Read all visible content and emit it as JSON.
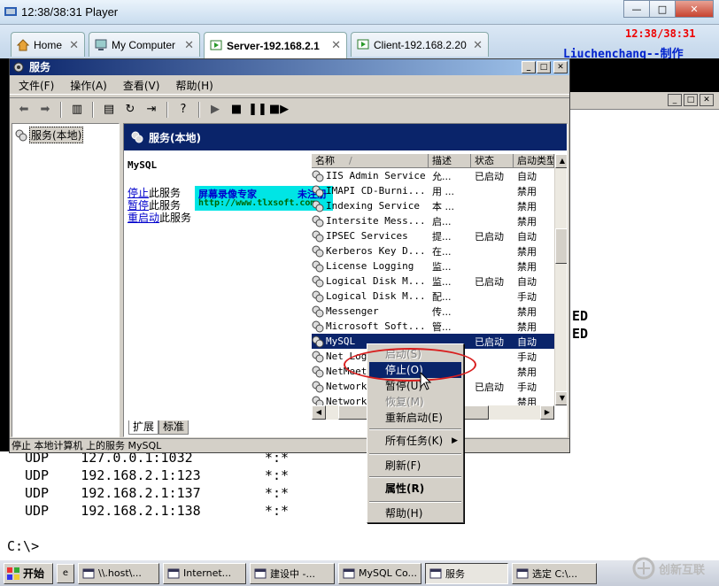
{
  "player": {
    "title": "12:38/38:31 Player",
    "controls": {
      "minimize": "—",
      "restore": "□",
      "close": "✕"
    }
  },
  "tabs": [
    {
      "label": "Home",
      "close": "✕"
    },
    {
      "label": "My Computer",
      "close": "✕"
    },
    {
      "label": "Server-192.168.2.1",
      "close": "✕"
    },
    {
      "label": "Client-192.168.2.20",
      "close": "✕"
    }
  ],
  "overlay": {
    "clock": "12:38/38:31",
    "author": "Liuchenchang--制作"
  },
  "services_window": {
    "title": "服务",
    "controls": {
      "minimize": "_",
      "maximize": "□",
      "close": "✕"
    },
    "menu": [
      "文件(F)",
      "操作(A)",
      "查看(V)",
      "帮助(H)"
    ],
    "tree_root": "服务(本地)",
    "header": "服务(本地)",
    "selected_service_name": "MySQL",
    "actions": [
      {
        "link": "停止",
        "suffix": "此服务"
      },
      {
        "link": "暂停",
        "suffix": "此服务"
      },
      {
        "link": "重启动",
        "suffix": "此服务"
      }
    ],
    "columns": [
      "名称",
      "描述",
      "状态",
      "启动类型"
    ],
    "sort_marker": "/",
    "services": [
      {
        "name": "IIS Admin Service",
        "desc": "允...",
        "status": "已启动",
        "startup": "自动",
        "selected": false
      },
      {
        "name": "IMAPI CD-Burni...",
        "desc": "用 ...",
        "status": "",
        "startup": "禁用",
        "selected": false
      },
      {
        "name": "Indexing Service",
        "desc": "本 ...",
        "status": "",
        "startup": "禁用",
        "selected": false
      },
      {
        "name": "Intersite Mess...",
        "desc": "启...",
        "status": "",
        "startup": "禁用",
        "selected": false
      },
      {
        "name": "IPSEC Services",
        "desc": "提...",
        "status": "已启动",
        "startup": "自动",
        "selected": false
      },
      {
        "name": "Kerberos Key D...",
        "desc": "在...",
        "status": "",
        "startup": "禁用",
        "selected": false
      },
      {
        "name": "License Logging",
        "desc": "监...",
        "status": "",
        "startup": "禁用",
        "selected": false
      },
      {
        "name": "Logical Disk M...",
        "desc": "监...",
        "status": "已启动",
        "startup": "自动",
        "selected": false
      },
      {
        "name": "Logical Disk M...",
        "desc": "配...",
        "status": "",
        "startup": "手动",
        "selected": false
      },
      {
        "name": "Messenger",
        "desc": "传...",
        "status": "",
        "startup": "禁用",
        "selected": false
      },
      {
        "name": "Microsoft Soft...",
        "desc": "管...",
        "status": "",
        "startup": "禁用",
        "selected": false
      },
      {
        "name": "MySQL",
        "desc": "",
        "status": "已启动",
        "startup": "自动",
        "selected": true
      },
      {
        "name": "Net Logon",
        "desc": "",
        "status": "",
        "startup": "手动",
        "selected": false
      },
      {
        "name": "NetMeeting",
        "desc": "",
        "status": "",
        "startup": "禁用",
        "selected": false
      },
      {
        "name": "Network",
        "desc": "",
        "status": "已启动",
        "startup": "手动",
        "selected": false
      },
      {
        "name": "Network",
        "desc": "",
        "status": "",
        "startup": "禁用",
        "selected": false
      }
    ],
    "view_tabs": [
      "扩展",
      "标准"
    ],
    "status_text": "停止 本地计算机 上的服务 MySQL"
  },
  "watermark": {
    "line1": "屏幕录像专家",
    "line1b": "未注册",
    "line2": "http://www.tlxsoft.com"
  },
  "context_menu": {
    "items": [
      {
        "label": "启动(S)",
        "disabled": true
      },
      {
        "label": "停止(O)",
        "highlighted": true
      },
      {
        "label": "暂停(U)"
      },
      {
        "label": "恢复(M)",
        "disabled": true
      },
      {
        "label": "重新启动(E)"
      },
      {
        "label": "所有任务(K)",
        "submenu": "▶"
      },
      {
        "label": "刷新(F)"
      },
      {
        "label": "属性(R)",
        "bold": true
      },
      {
        "label": "帮助(H)"
      }
    ]
  },
  "background_cmd": {
    "right_fragments": [
      "ED",
      "ED"
    ],
    "lines": [
      "UDP    127.0.0.1:1032         *:*",
      "UDP    192.168.2.1:123        *:*",
      "UDP    192.168.2.1:137        *:*",
      "UDP    192.168.2.1:138        *:*"
    ],
    "prompt": "C:\\>"
  },
  "taskbar": {
    "start_label": "开始",
    "tasks": [
      {
        "label": "\\\\.host\\..."
      },
      {
        "label": "Internet..."
      },
      {
        "label": "建设中 -..."
      },
      {
        "label": "MySQL Co..."
      },
      {
        "label": "服务",
        "active": true
      },
      {
        "label": "选定 C:\\..."
      }
    ]
  },
  "brand_logo": "创新互联",
  "colors": {
    "highlight": "#0a246a",
    "annotation": "#d81e1e",
    "clock": "#ee0000",
    "author": "#0022cc"
  }
}
